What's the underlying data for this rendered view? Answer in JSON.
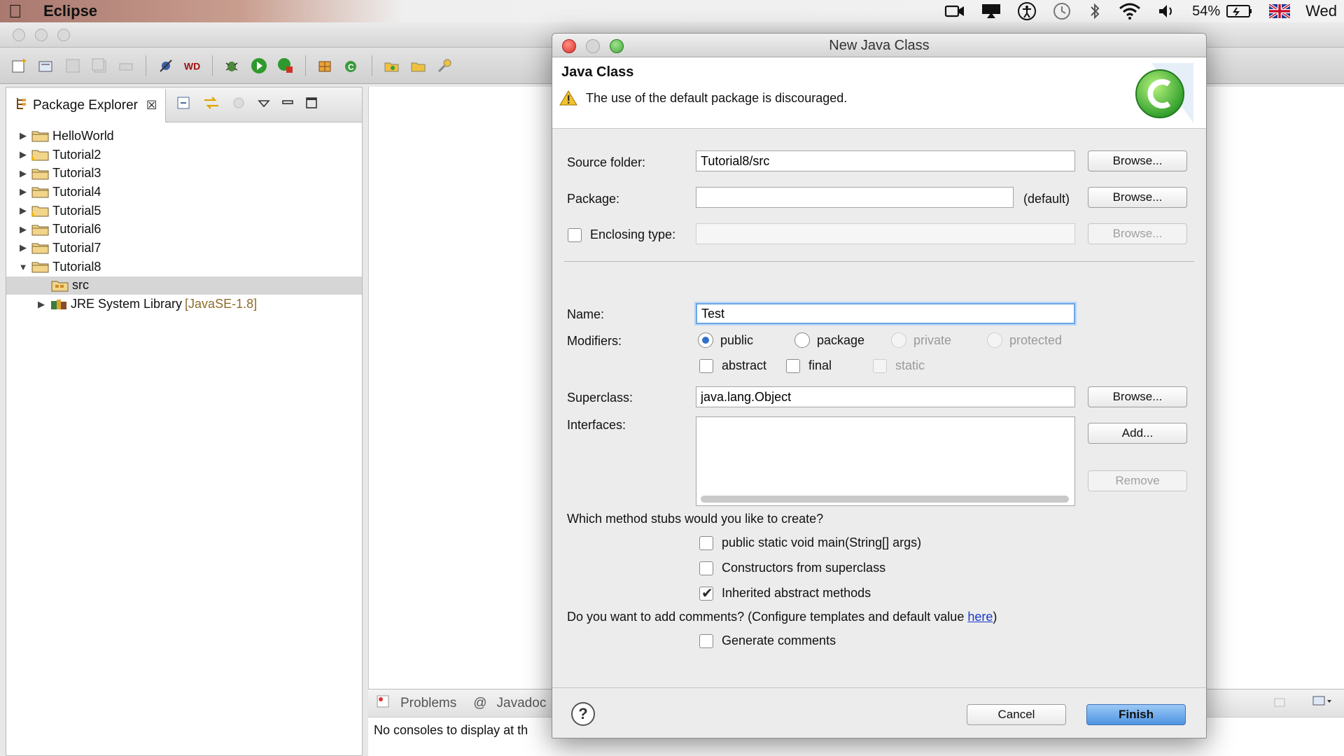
{
  "menubar": {
    "app_name": "Eclipse",
    "battery": "54%",
    "clock": "Wed"
  },
  "package_explorer": {
    "tab_label": "Package Explorer",
    "items": [
      {
        "label": "HelloWorld",
        "suffix": ""
      },
      {
        "label": "Tutorial2",
        "suffix": ""
      },
      {
        "label": "Tutorial3",
        "suffix": ""
      },
      {
        "label": "Tutorial4",
        "suffix": ""
      },
      {
        "label": "Tutorial5",
        "suffix": ""
      },
      {
        "label": "Tutorial6",
        "suffix": ""
      },
      {
        "label": "Tutorial7",
        "suffix": ""
      },
      {
        "label": "Tutorial8",
        "suffix": ""
      },
      {
        "label": "src",
        "suffix": ""
      },
      {
        "label": "JRE System Library",
        "suffix": "[JavaSE-1.8]"
      }
    ]
  },
  "bottom_panel": {
    "tabs": [
      "Problems",
      "Javadoc"
    ],
    "message": "No consoles to display at th"
  },
  "dialog": {
    "title": "New Java Class",
    "heading": "Java Class",
    "warning": "The use of the default package is discouraged.",
    "labels": {
      "source_folder": "Source folder:",
      "package": "Package:",
      "package_default": "(default)",
      "enclosing_type": "Enclosing type:",
      "name": "Name:",
      "modifiers": "Modifiers:",
      "superclass": "Superclass:",
      "interfaces": "Interfaces:",
      "stubs_question": "Which method stubs would you like to create?",
      "comments_question": "Do you want to add comments? (Configure templates and default value ",
      "comments_link": "here",
      "comments_close": ")"
    },
    "values": {
      "source_folder": "Tutorial8/src",
      "package": "",
      "enclosing_type": "",
      "name": "Test",
      "superclass": "java.lang.Object"
    },
    "buttons": {
      "browse": "Browse...",
      "add": "Add...",
      "remove": "Remove",
      "cancel": "Cancel",
      "finish": "Finish",
      "help": "?"
    },
    "modifiers": {
      "public": "public",
      "package": "package",
      "private": "private",
      "protected": "protected",
      "abstract": "abstract",
      "final": "final",
      "static": "static"
    },
    "stubs": {
      "main": "public static void main(String[] args)",
      "constructors": "Constructors from superclass",
      "inherited": "Inherited abstract methods"
    },
    "generate_comments": "Generate comments"
  }
}
